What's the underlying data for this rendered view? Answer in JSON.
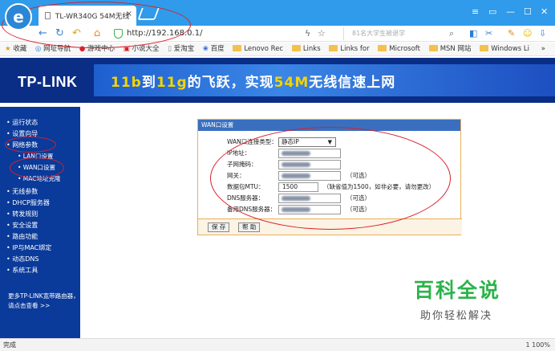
{
  "browser": {
    "tab_title": "TL-WR340G 54M无线",
    "tab_close": "×",
    "url": "http://192.168.0.1/",
    "search_placeholder": "81名大学生被退学",
    "window_controls": [
      "≡",
      "▭",
      "—",
      "☐",
      "✕"
    ],
    "bookmarks": [
      {
        "label": "收藏",
        "icon": "star-icon"
      },
      {
        "label": "网址导航",
        "icon": "globe-icon"
      },
      {
        "label": "游戏中心",
        "icon": "game-icon"
      },
      {
        "label": "小说大全",
        "icon": "book-icon"
      },
      {
        "label": "爱淘宝",
        "icon": "page-icon"
      },
      {
        "label": "百度",
        "icon": "paw-icon"
      },
      {
        "label": "Lenovo Rec",
        "icon": "folder-icon"
      },
      {
        "label": "Links",
        "icon": "folder-icon"
      },
      {
        "label": "Links for",
        "icon": "folder-icon"
      },
      {
        "label": "Microsoft",
        "icon": "folder-icon"
      },
      {
        "label": "MSN 网站",
        "icon": "folder-icon"
      },
      {
        "label": "Windows Li",
        "icon": "folder-icon"
      }
    ],
    "bookmarks_more": "»",
    "status_left": "完成",
    "status_right": "1  100%"
  },
  "banner": {
    "logo": "TP-LINK",
    "slogan_pre": "11b",
    "slogan_mid1": "到",
    "slogan_mid2": "11g",
    "slogan_mid3": "的飞跃，实现",
    "slogan_hl": "54M",
    "slogan_post": "无线信速上网"
  },
  "sidebar": {
    "items": [
      {
        "label": "• 运行状态",
        "sub": false
      },
      {
        "label": "• 设置向导",
        "sub": false
      },
      {
        "label": "• 网络参数",
        "sub": false
      },
      {
        "label": "• LAN口设置",
        "sub": true
      },
      {
        "label": "• WAN口设置",
        "sub": true
      },
      {
        "label": "• MAC地址克隆",
        "sub": true
      },
      {
        "label": "• 无线参数",
        "sub": false
      },
      {
        "label": "• DHCP服务器",
        "sub": false
      },
      {
        "label": "• 转发规则",
        "sub": false
      },
      {
        "label": "• 安全设置",
        "sub": false
      },
      {
        "label": "• 路由功能",
        "sub": false
      },
      {
        "label": "• IP与MAC绑定",
        "sub": false
      },
      {
        "label": "• 动态DNS",
        "sub": false
      },
      {
        "label": "• 系统工具",
        "sub": false
      }
    ],
    "help": "更多TP-LINK宽带路由器，请点击查看 >>"
  },
  "form": {
    "title": "WAN口设置",
    "conn_type_label": "WAN口连接类型：",
    "conn_type_value": "静态IP",
    "rows": [
      {
        "label": "IP地址：",
        "hint": ""
      },
      {
        "label": "子网掩码：",
        "hint": ""
      },
      {
        "label": "网关：",
        "hint": "（可选）"
      },
      {
        "label": "数据包MTU：",
        "value": "1500",
        "hint": "（缺省值为1500，如非必要，请勿更改）"
      },
      {
        "label": "DNS服务器：",
        "hint": "（可选）"
      },
      {
        "label": "备用DNS服务器：",
        "hint": "（可选）"
      }
    ],
    "save": "保 存",
    "help": "帮 助"
  },
  "watermark": {
    "title": "百科全说",
    "subtitle": "助你轻松解决"
  },
  "colors": {
    "browser_blue": "#2f9bea",
    "sidebar_blue": "#0a3a9a",
    "panel_header": "#3a6fbf",
    "annotation_red": "#d9202a",
    "watermark_green": "#2bb34a"
  }
}
